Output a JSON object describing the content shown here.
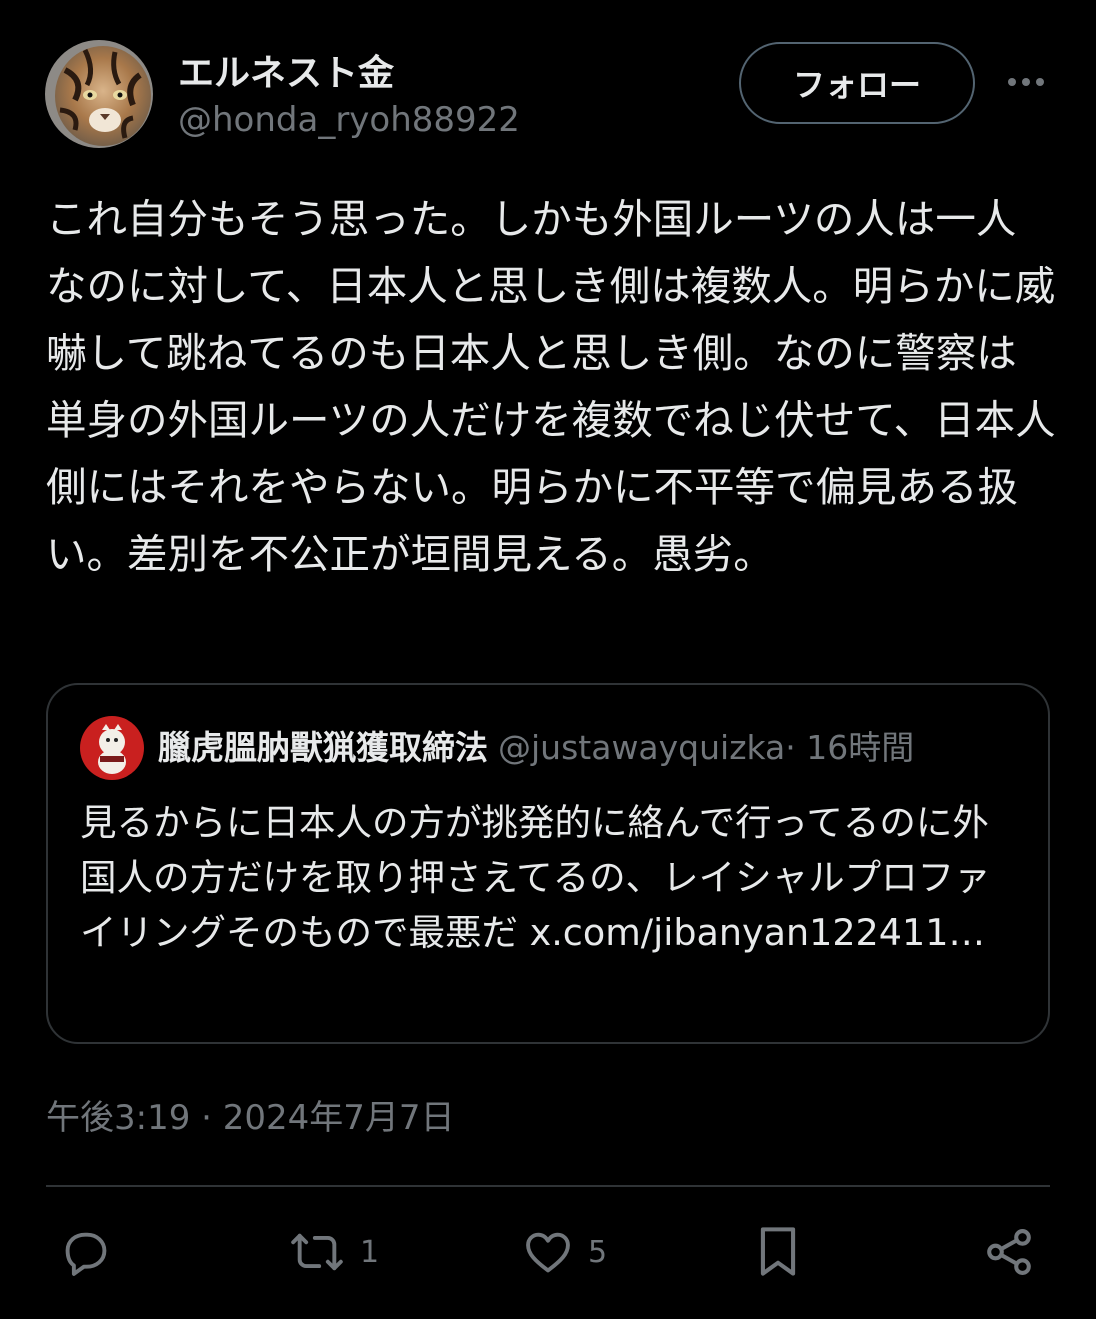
{
  "author": {
    "display_name": "エルネスト金",
    "handle": "@honda_ryoh88922"
  },
  "follow_label": "フォロー",
  "tweet_text": "これ自分もそう思った。しかも外国ルーツの人は一人なのに対して、日本人と思しき側は複数人。明らかに威嚇して跳ねてるのも日本人と思しき側。なのに警察は単身の外国ルーツの人だけを複数でねじ伏せて、日本人側にはそれをやらない。明らかに不平等で偏見ある扱い。差別を不公正が垣間見える。愚劣。",
  "quote": {
    "display_name": "臘虎膃肭獸猟獲取締法",
    "handle": "@justawayquizka",
    "time": "· 16時間",
    "text": "見るからに日本人の方が挑発的に絡んで行ってるのに外国人の方だけを取り押さえてるの、レイシャルプロファイリングそのもので最悪だ ",
    "link": "x.com/jibanyan122411…"
  },
  "timestamp": "午後3:19 · 2024年7月7日",
  "actions": {
    "reply_count": "",
    "retweet_count": "1",
    "like_count": "5"
  },
  "icons": {
    "more": "more-horizontal-icon",
    "reply": "reply-icon",
    "retweet": "retweet-icon",
    "like": "heart-icon",
    "bookmark": "bookmark-icon",
    "share": "share-icon"
  },
  "colors": {
    "background": "#000000",
    "text_primary": "#e7e9ea",
    "text_secondary": "#71767b",
    "border": "#2f3336"
  }
}
